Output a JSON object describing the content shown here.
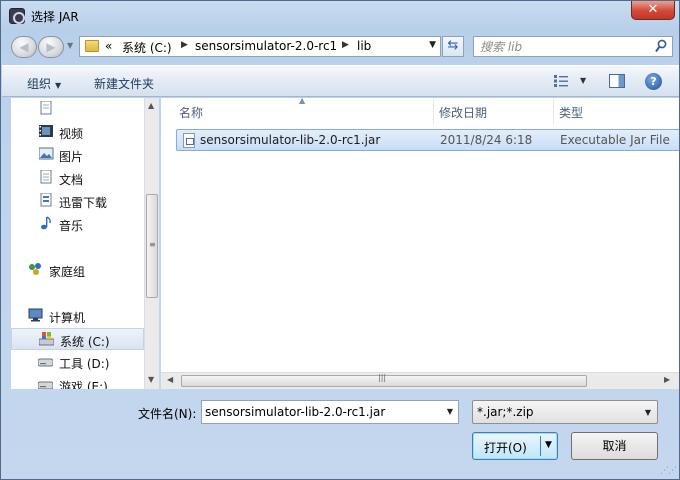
{
  "window": {
    "title": "选择 JAR",
    "close_label": "✕"
  },
  "address": {
    "prefix": "«",
    "crumbs": [
      "系统 (C:)",
      "sensorsimulator-2.0-rc1",
      "lib"
    ]
  },
  "search": {
    "placeholder": "搜索 lib"
  },
  "toolbar": {
    "organize_label": "组织",
    "new_folder_label": "新建文件夹",
    "help_label": "?"
  },
  "nav": {
    "items": [
      {
        "label": "",
        "icon": "document-icon"
      },
      {
        "label": "视频",
        "icon": "video-icon"
      },
      {
        "label": "图片",
        "icon": "picture-icon"
      },
      {
        "label": "文档",
        "icon": "document-icon"
      },
      {
        "label": "迅雷下载",
        "icon": "download-icon"
      },
      {
        "label": "音乐",
        "icon": "music-icon"
      },
      {
        "label": "家庭组",
        "icon": "homegroup-icon"
      },
      {
        "label": "计算机",
        "icon": "computer-icon"
      },
      {
        "label": "系统 (C:)",
        "icon": "drive-icon"
      },
      {
        "label": "工具 (D:)",
        "icon": "drive-icon"
      },
      {
        "label": "游戏 (E:)",
        "icon": "drive-icon"
      }
    ]
  },
  "columns": {
    "name": "名称",
    "modified": "修改日期",
    "type": "类型"
  },
  "files": [
    {
      "name": "sensorsimulator-lib-2.0-rc1.jar",
      "modified": "2011/8/24 6:18",
      "type": "Executable Jar File"
    }
  ],
  "footer": {
    "filename_label": "文件名(N):",
    "filename_value": "sensorsimulator-lib-2.0-rc1.jar",
    "filter_value": "*.jar;*.zip",
    "open_label": "打开(O)",
    "cancel_label": "取消"
  },
  "colors": {
    "accent": "#3c7fb1",
    "selection": "#c9ddf6",
    "close": "#d2483a"
  }
}
